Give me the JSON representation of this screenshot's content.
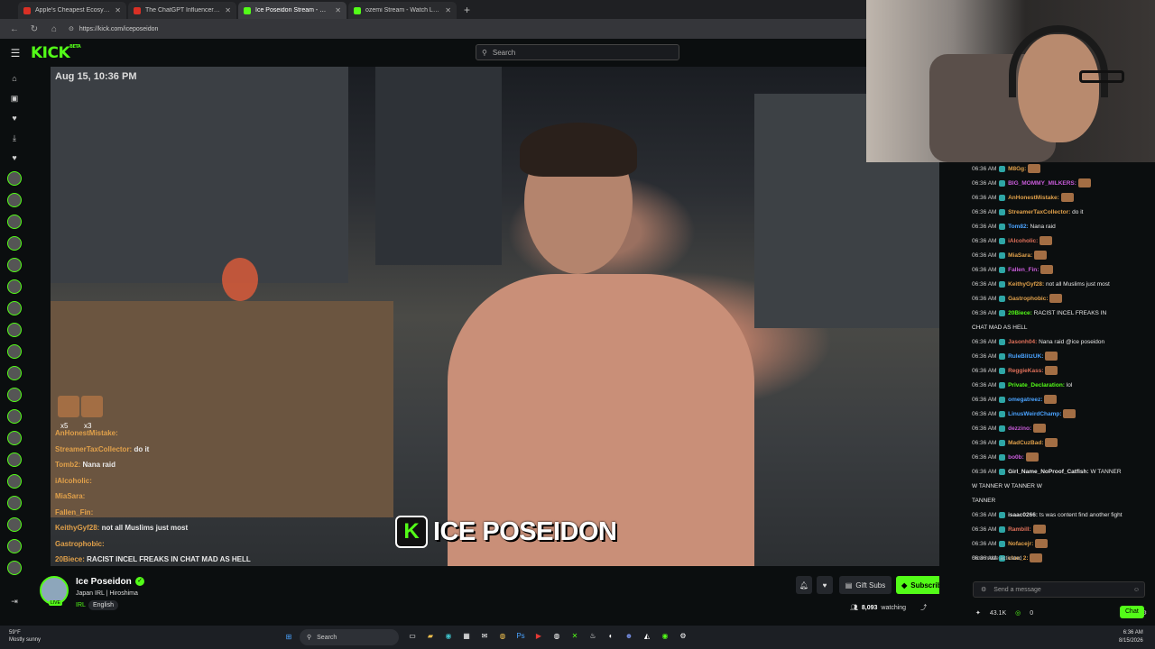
{
  "browser": {
    "tabs": [
      {
        "title": "Apple's Cheapest Ecosystem Beats...",
        "color": "#d93025"
      },
      {
        "title": "The ChatGPT Influencer Trip Just...",
        "color": "#d93025"
      },
      {
        "title": "Ice Poseidon Stream - Watch Live on...",
        "color": "#53fc18",
        "active": true
      },
      {
        "title": "ozemi Stream - Watch Live on Kick",
        "color": "#53fc18"
      }
    ],
    "new_tab": "+",
    "url": "https://kick.com/iceposeidon"
  },
  "kick": {
    "logo": "KICK",
    "logo_badge": "BETA",
    "search_placeholder": "Search",
    "video": {
      "timestamp": "Aug 15, 10:36 PM",
      "watermark": "ICE POSEIDON",
      "emote_counts": [
        "x5",
        "x3"
      ],
      "overlay_chat": [
        {
          "user": "AnHonestMistake:",
          "text": ""
        },
        {
          "user": "StreamerTaxCollector:",
          "text": "do it"
        },
        {
          "user": "Tomb2:",
          "text": "Nana raid"
        },
        {
          "user": "iAlcoholic:",
          "text": ""
        },
        {
          "user": "MiaSara:",
          "text": ""
        },
        {
          "user": "Fallen_Fin:",
          "text": ""
        },
        {
          "user": "KeithyGyf28:",
          "text": "not all Muslims just most"
        },
        {
          "user": "Gastrophobic:",
          "text": ""
        },
        {
          "user": "20Biece:",
          "text": "RACIST INCEL FREAKS IN CHAT MAD AS HELL"
        }
      ]
    },
    "streamer": {
      "name": "Ice Poseidon",
      "live_badge": "LIVE",
      "title": "Japan IRL | Hiroshima",
      "category": "IRL",
      "language": "English",
      "gift_label": "Gift Subs",
      "subscribe_label": "Subscribe",
      "viewers": "8,093",
      "viewers_label": "watching"
    },
    "chat": {
      "messages": [
        {
          "time": "06:36 AM",
          "user": "M8Gg:",
          "color": "#e0a04a",
          "text": ""
        },
        {
          "time": "06:36 AM",
          "user": "BIG_MOMMY_MILKERS:",
          "color": "#c85bd9",
          "text": ""
        },
        {
          "time": "06:36 AM",
          "user": "AnHonestMistake:",
          "color": "#e0a04a",
          "text": ""
        },
        {
          "time": "06:36 AM",
          "user": "StreamerTaxCollector:",
          "color": "#e0a04a",
          "text": "do it"
        },
        {
          "time": "06:36 AM",
          "user": "Tom82:",
          "color": "#4aa3ff",
          "text": "Nana raid"
        },
        {
          "time": "06:36 AM",
          "user": "iAlcoholic:",
          "color": "#e0705a",
          "text": ""
        },
        {
          "time": "06:36 AM",
          "user": "MiaSara:",
          "color": "#e0a04a",
          "text": ""
        },
        {
          "time": "06:36 AM",
          "user": "Fallen_Fin:",
          "color": "#c85bd9",
          "text": ""
        },
        {
          "time": "06:36 AM",
          "user": "KeithyGyf28:",
          "color": "#e0a04a",
          "text": "not all Muslims just most"
        },
        {
          "time": "06:36 AM",
          "user": "Gastrophobic:",
          "color": "#e0a04a",
          "text": ""
        },
        {
          "time": "06:36 AM",
          "user": "20Biece:",
          "color": "#53fc18",
          "text": "RACIST INCEL FREAKS IN"
        },
        {
          "time": "",
          "user": "",
          "color": "#e8e8e8",
          "text": "CHAT MAD AS HELL"
        },
        {
          "time": "06:36 AM",
          "user": "Jasonh04:",
          "color": "#e0705a",
          "text": "Nana raid @ice poseidon"
        },
        {
          "time": "06:36 AM",
          "user": "RuleBlitzUK:",
          "color": "#4aa3ff",
          "text": ""
        },
        {
          "time": "06:36 AM",
          "user": "ReggieKass:",
          "color": "#e0705a",
          "text": ""
        },
        {
          "time": "06:36 AM",
          "user": "Private_Declaration:",
          "color": "#53fc18",
          "text": "lol"
        },
        {
          "time": "06:36 AM",
          "user": "omegatreez:",
          "color": "#4aa3ff",
          "text": ""
        },
        {
          "time": "06:36 AM",
          "user": "LinusWeirdChamp:",
          "color": "#4aa3ff",
          "text": ""
        },
        {
          "time": "06:36 AM",
          "user": "dezzino:",
          "color": "#c85bd9",
          "text": ""
        },
        {
          "time": "06:36 AM",
          "user": "MadCuzBad:",
          "color": "#e0a04a",
          "text": ""
        },
        {
          "time": "06:36 AM",
          "user": "bo0b:",
          "color": "#c85bd9",
          "text": ""
        },
        {
          "time": "06:36 AM",
          "user": "Girl_Name_NoProof_Catfish:",
          "color": "#e8e8e8",
          "text": "W TANNER"
        },
        {
          "time": "",
          "user": "",
          "color": "#e8e8e8",
          "text": "W TANNER   W TANNER   W"
        },
        {
          "time": "",
          "user": "",
          "color": "#e8e8e8",
          "text": "TANNER"
        },
        {
          "time": "06:36 AM",
          "user": "isaac0266:",
          "color": "#e8e8e8",
          "text": "ts was content find another fight"
        },
        {
          "time": "06:36 AM",
          "user": "Rambill:",
          "color": "#e0705a",
          "text": ""
        },
        {
          "time": "06:36 AM",
          "user": "Nofacejr:",
          "color": "#e0a04a",
          "text": ""
        },
        {
          "time": "06:36 AM",
          "user": "clue_2:",
          "color": "#e0a04a",
          "text": ""
        }
      ],
      "slow_mode": "Slow mode activated",
      "input_placeholder": "Send a message",
      "points": "43.1K",
      "zero_count": "0",
      "chat_button": "Chat"
    }
  },
  "taskbar": {
    "weather_temp": "59°F",
    "weather_desc": "Mostly sunny",
    "search_placeholder": "Search",
    "time": "6:36 AM",
    "date": "8/15/2026"
  }
}
